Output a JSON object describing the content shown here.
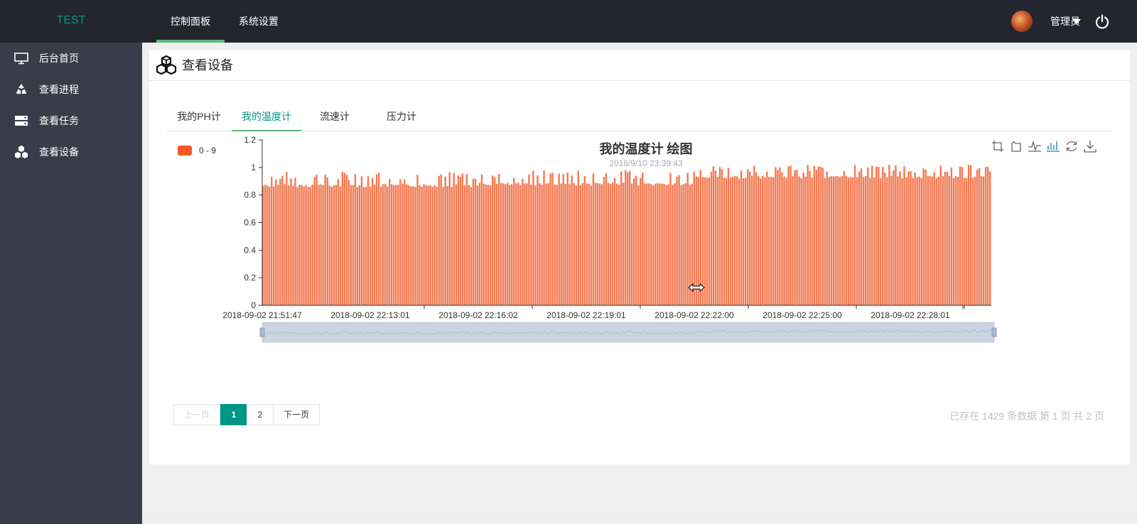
{
  "app": {
    "logo": "TEST",
    "nav": [
      {
        "label": "控制面板",
        "active": true
      },
      {
        "label": "系统设置",
        "active": false
      }
    ],
    "user": "管理员"
  },
  "sidebar": {
    "items": [
      {
        "label": "后台首页",
        "icon": "monitor-icon"
      },
      {
        "label": "查看进程",
        "icon": "recycle-icon"
      },
      {
        "label": "查看任务",
        "icon": "server-icon"
      },
      {
        "label": "查看设备",
        "icon": "cubes-icon"
      }
    ]
  },
  "page": {
    "title": "查看设备",
    "tabs": [
      {
        "label": "我的PH计",
        "active": false
      },
      {
        "label": "我的温度计",
        "active": true
      },
      {
        "label": "流速计",
        "active": false
      },
      {
        "label": "压力计",
        "active": false
      }
    ]
  },
  "chart_data": {
    "type": "bar",
    "title": "我的温度计 绘图",
    "subtitle": "2018/9/10 23:39:43",
    "legend": [
      "0 - 9"
    ],
    "legend_position": "top-left",
    "color": "#f4592a",
    "ylim": [
      0,
      1.2
    ],
    "yticks": [
      "0",
      "0.2",
      "0.4",
      "0.6",
      "0.8",
      "1",
      "1.2"
    ],
    "xticks": [
      "2018-09-02 21:51:47",
      "2018-09-02 22:13:01",
      "2018-09-02 22:16:02",
      "2018-09-02 22:19:01",
      "2018-09-02 22:22:00",
      "2018-09-02 22:25:00",
      "2018-09-02 22:28:01"
    ],
    "grid": false,
    "toolbox": [
      "zoom-icon",
      "zoom-reset-icon",
      "line-chart-icon",
      "bar-chart-icon",
      "refresh-icon",
      "download-icon"
    ],
    "segments": [
      {
        "from_tick": 0,
        "to_tick": 2,
        "mean": 0.88,
        "spread": 0.09
      },
      {
        "from_tick": 2,
        "to_tick": 4,
        "mean": 0.89,
        "spread": 0.09
      },
      {
        "from_tick": 4,
        "to_tick": 6,
        "mean": 0.94,
        "spread": 0.08
      }
    ],
    "slider": {
      "start": 0,
      "end": 100
    }
  },
  "pagination": {
    "prev": "上一页",
    "next": "下一页",
    "pages": [
      "1",
      "2"
    ],
    "current": 1,
    "info": "已存在 1429 条数据  第 1 页  共 2 页"
  }
}
